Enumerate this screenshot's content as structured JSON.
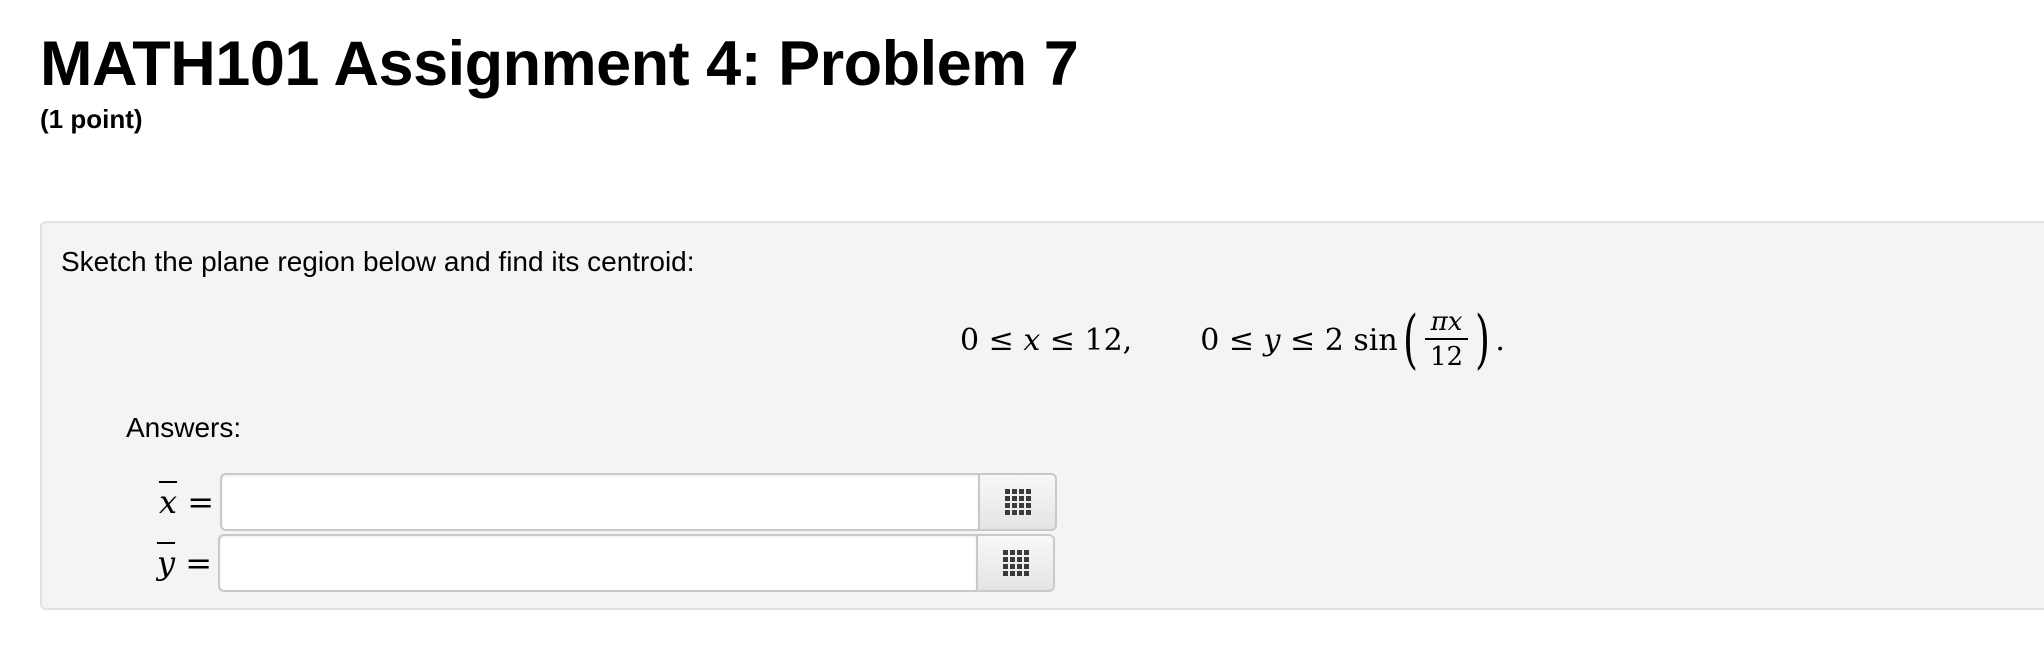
{
  "header": {
    "title": "MATH101 Assignment 4: Problem 7",
    "points": "(1 point)"
  },
  "problem": {
    "statement": "Sketch the plane region below and find its centroid:",
    "equation": {
      "x_range": {
        "lower": "0",
        "le1": "≤",
        "var": "x",
        "le2": "≤",
        "upper": "12,"
      },
      "y_range": {
        "lower": "0",
        "le1": "≤",
        "var": "y",
        "le2": "≤",
        "coef": "2",
        "func": "sin",
        "left_paren": "(",
        "numerator": "πx",
        "denominator": "12",
        "right_paren": ")",
        "end": "."
      }
    }
  },
  "answers": {
    "label": "Answers:",
    "fields": [
      {
        "variable": "x",
        "equals": "=",
        "value": "",
        "editor_icon": "grid-icon"
      },
      {
        "variable": "y",
        "equals": "=",
        "value": "",
        "editor_icon": "grid-icon"
      }
    ]
  }
}
